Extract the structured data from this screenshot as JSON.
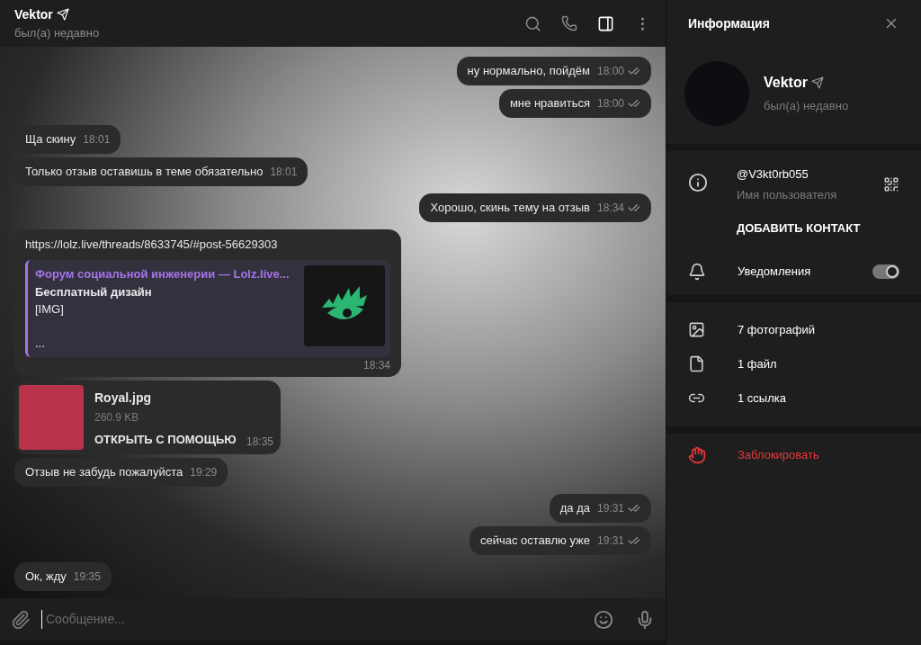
{
  "header": {
    "name": "Vektor",
    "status": "был(а) недавно"
  },
  "messages": [
    {
      "kind": "text",
      "outgoing": true,
      "text": "ну нормально, пойдём",
      "time": "18:00",
      "read": true
    },
    {
      "kind": "text",
      "outgoing": true,
      "text": "мне нравиться",
      "time": "18:00",
      "read": true
    },
    {
      "kind": "text",
      "outgoing": false,
      "text": "Ща скину",
      "time": "18:01"
    },
    {
      "kind": "text",
      "outgoing": false,
      "text": "Только отзыв оставишь в теме обязательно",
      "time": "18:01"
    },
    {
      "kind": "text",
      "outgoing": true,
      "text": "Хорошо, скинь тему на отзыв",
      "time": "18:34",
      "read": true
    },
    {
      "kind": "link",
      "outgoing": false,
      "text": "https://lolz.live/threads/8633745/#post-56629303",
      "preview": {
        "site": "Форум социальной инженерии —  Lolz.live...",
        "title": "Бесплатный дизайн",
        "lines": [
          "[IMG]",
          "..."
        ]
      },
      "time": "18:34"
    },
    {
      "kind": "file",
      "outgoing": false,
      "file_name": "Royal.jpg",
      "size": "260.9 KB",
      "action": "ОТКРЫТЬ С ПОМОЩЬЮ",
      "time": "18:35"
    },
    {
      "kind": "text",
      "outgoing": false,
      "text": "Отзыв не забудь пожалуйста",
      "time": "19:29"
    },
    {
      "kind": "text",
      "outgoing": true,
      "text": "да да",
      "time": "19:31",
      "read": true
    },
    {
      "kind": "text",
      "outgoing": true,
      "text": "сейчас оставлю уже",
      "time": "19:31",
      "read": true
    },
    {
      "kind": "text",
      "outgoing": false,
      "text": "Ок, жду",
      "time": "19:35"
    }
  ],
  "composer": {
    "placeholder": "Сообщение..."
  },
  "info_panel": {
    "title": "Информация",
    "name": "Vektor",
    "status": "был(а) недавно",
    "username": "@V3kt0rb055",
    "username_label": "Имя пользователя",
    "add_contact": "ДОБАВИТЬ КОНТАКТ",
    "notifications": {
      "label": "Уведомления",
      "on": true
    },
    "media": [
      {
        "kind": "photos",
        "label": "7 фотографий"
      },
      {
        "kind": "files",
        "label": "1 файл"
      },
      {
        "kind": "links",
        "label": "1 ссылка"
      }
    ],
    "block": "Заблокировать"
  }
}
